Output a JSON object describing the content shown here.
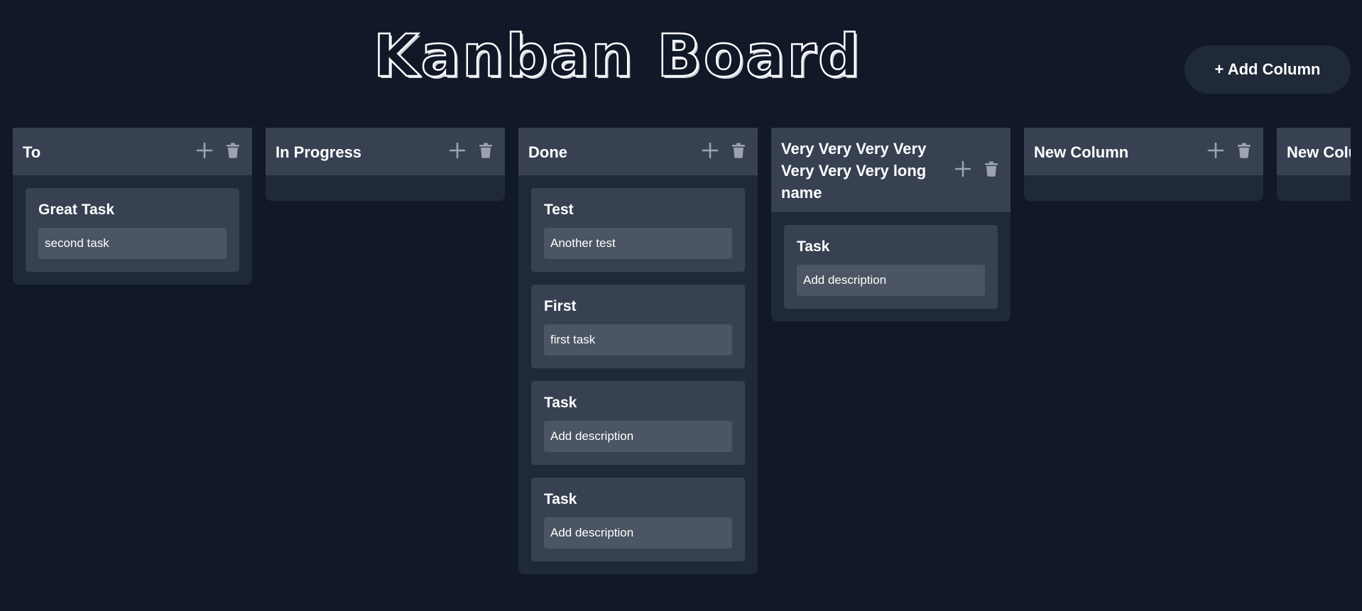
{
  "header": {
    "title": "Kanban Board",
    "add_column_label": "+ Add Column"
  },
  "icons": {
    "add": "plus-icon",
    "delete": "trash-icon"
  },
  "colors": {
    "background": "#111827",
    "column_body": "#1f2937",
    "column_header": "#374151",
    "task_card": "#374151",
    "task_description": "#4b5563",
    "icon": "#9ca3af"
  },
  "columns": [
    {
      "title": "To",
      "tasks": [
        {
          "title": "Great Task",
          "description": "second task"
        }
      ]
    },
    {
      "title": "In Progress",
      "tasks": []
    },
    {
      "title": "Done",
      "tasks": [
        {
          "title": "Test",
          "description": "Another test"
        },
        {
          "title": "First",
          "description": "first task"
        },
        {
          "title": "Task",
          "description": "Add description"
        },
        {
          "title": "Task",
          "description": "Add description"
        }
      ]
    },
    {
      "title": "Very Very Very Very Very Very Very long name",
      "tasks": [
        {
          "title": "Task",
          "description": "Add description"
        }
      ]
    },
    {
      "title": "New Column",
      "tasks": []
    },
    {
      "title": "New Column",
      "tasks": []
    }
  ]
}
